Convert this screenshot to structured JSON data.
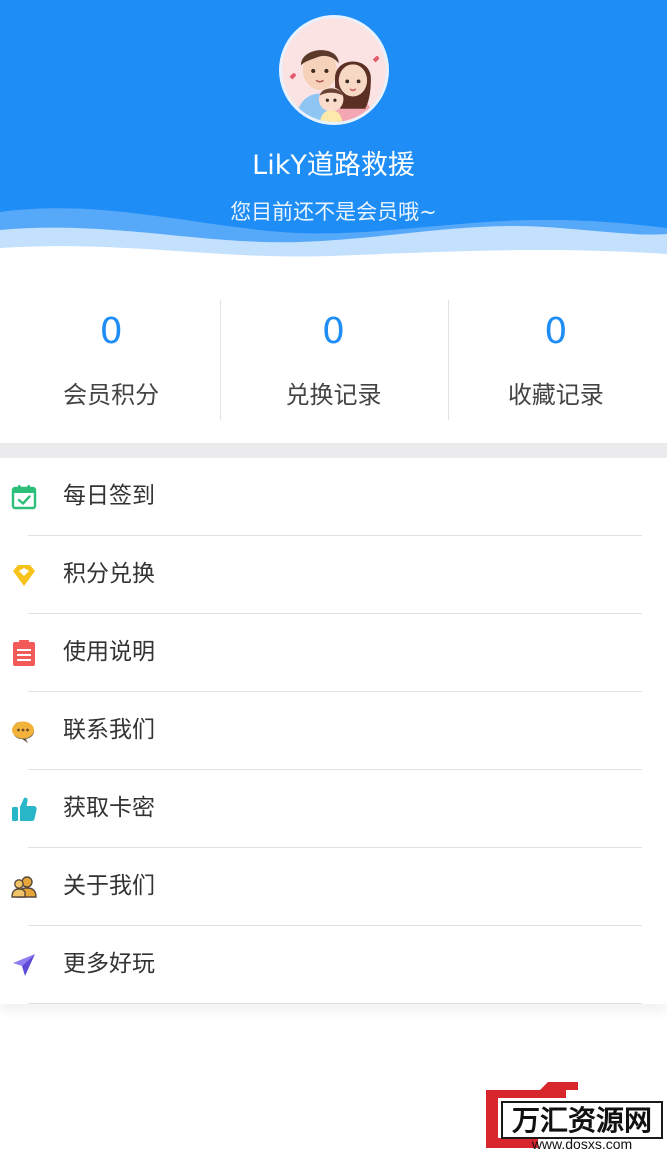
{
  "profile": {
    "username": "LikY道路救援",
    "member_status": "您目前还不是会员哦~"
  },
  "stats": [
    {
      "value": "0",
      "label": "会员积分"
    },
    {
      "value": "0",
      "label": "兑换记录"
    },
    {
      "value": "0",
      "label": "收藏记录"
    }
  ],
  "menu": [
    {
      "label": "每日签到",
      "icon": "calendar-check-icon",
      "color": "#2bbf7a"
    },
    {
      "label": "积分兑换",
      "icon": "diamond-icon",
      "color": "#f7c21b"
    },
    {
      "label": "使用说明",
      "icon": "document-list-icon",
      "color": "#f25a5a"
    },
    {
      "label": "联系我们",
      "icon": "chat-bubble-icon",
      "color": "#f2b33d"
    },
    {
      "label": "获取卡密",
      "icon": "thumbs-up-icon",
      "color": "#27b7c9"
    },
    {
      "label": "关于我们",
      "icon": "people-icon",
      "color": "#e8a53a"
    },
    {
      "label": "更多好玩",
      "icon": "paper-plane-icon",
      "color": "#6c5ce7"
    }
  ],
  "watermark": {
    "text": "万汇资源网",
    "url_text": "www.dosxs.com"
  },
  "colors": {
    "accent": "#1e8df5",
    "divider": "#e1e1e1",
    "section_gap": "#ebebed"
  }
}
